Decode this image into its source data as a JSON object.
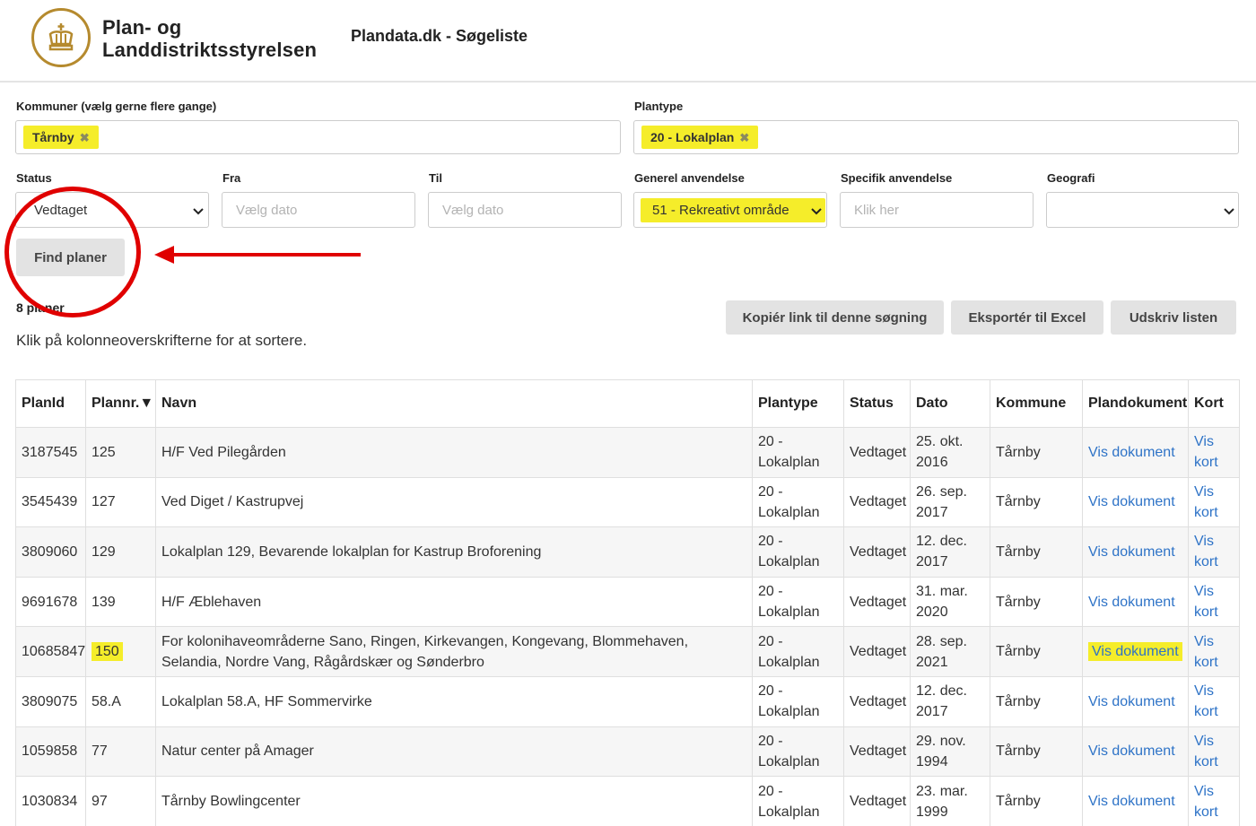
{
  "header": {
    "org_line1": "Plan- og",
    "org_line2": "Landdistriktsstyrelsen",
    "site_title": "Plandata.dk - Søgeliste"
  },
  "filters": {
    "kommuner_label": "Kommuner (vælg gerne flere gange)",
    "kommuner_tag": "Tårnby",
    "plantype_label": "Plantype",
    "plantype_tag": "20 - Lokalplan",
    "status_label": "Status",
    "status_value": "Vedtaget",
    "fra_label": "Fra",
    "fra_placeholder": "Vælg dato",
    "til_label": "Til",
    "til_placeholder": "Vælg dato",
    "generel_label": "Generel anvendelse",
    "generel_value": "51 - Rekreativt område",
    "specifik_label": "Specifik anvendelse",
    "specifik_placeholder": "Klik her",
    "geografi_label": "Geografi",
    "geografi_value": "",
    "tag_remove_glyph": "✖"
  },
  "actions": {
    "find": "Find planer",
    "copy_link": "Kopiér link til denne søgning",
    "export": "Eksportér til Excel",
    "print": "Udskriv listen"
  },
  "results": {
    "count": "8 planer",
    "hint": "Klik på kolonneoverskrifterne for at sortere."
  },
  "table": {
    "headers": [
      "PlanId",
      "Plannr.▼",
      "Navn",
      "Plantype",
      "Status",
      "Dato",
      "Kommune",
      "Plandokument",
      "Kort"
    ],
    "rows": [
      {
        "id": "3187545",
        "nr": "125",
        "navn": "H/F Ved Pilegården",
        "type1": "20 -",
        "type2": "Lokalplan",
        "status": "Vedtaget",
        "dato1": "25. okt.",
        "dato2": "2016",
        "kommune": "Tårnby",
        "dok": "Vis dokument",
        "kort1": "Vis",
        "kort2": "kort"
      },
      {
        "id": "3545439",
        "nr": "127",
        "navn": "Ved Diget / Kastrupvej",
        "type1": "20 -",
        "type2": "Lokalplan",
        "status": "Vedtaget",
        "dato1": "26. sep.",
        "dato2": "2017",
        "kommune": "Tårnby",
        "dok": "Vis dokument",
        "kort1": "Vis",
        "kort2": "kort"
      },
      {
        "id": "3809060",
        "nr": "129",
        "navn": "Lokalplan 129, Bevarende lokalplan for Kastrup Broforening",
        "type1": "20 -",
        "type2": "Lokalplan",
        "status": "Vedtaget",
        "dato1": "12. dec.",
        "dato2": "2017",
        "kommune": "Tårnby",
        "dok": "Vis dokument",
        "kort1": "Vis",
        "kort2": "kort"
      },
      {
        "id": "9691678",
        "nr": "139",
        "navn": "H/F Æblehaven",
        "type1": "20 -",
        "type2": "Lokalplan",
        "status": "Vedtaget",
        "dato1": "31. mar.",
        "dato2": "2020",
        "kommune": "Tårnby",
        "dok": "Vis dokument",
        "kort1": "Vis",
        "kort2": "kort"
      },
      {
        "id": "10685847",
        "nr": "150",
        "navn": "For kolonihaveområderne Sano, Ringen, Kirkevangen, Kongevang, Blommehaven, Selandia, Nordre Vang, Rågårdskær og Sønderbro",
        "type1": "20 -",
        "type2": "Lokalplan",
        "status": "Vedtaget",
        "dato1": "28. sep.",
        "dato2": "2021",
        "kommune": "Tårnby",
        "dok": "Vis dokument",
        "kort1": "Vis",
        "kort2": "kort"
      },
      {
        "id": "3809075",
        "nr": "58.A",
        "navn": "Lokalplan 58.A, HF Sommervirke",
        "type1": "20 -",
        "type2": "Lokalplan",
        "status": "Vedtaget",
        "dato1": "12. dec.",
        "dato2": "2017",
        "kommune": "Tårnby",
        "dok": "Vis dokument",
        "kort1": "Vis",
        "kort2": "kort"
      },
      {
        "id": "1059858",
        "nr": "77",
        "navn": "Natur center på Amager",
        "type1": "20 -",
        "type2": "Lokalplan",
        "status": "Vedtaget",
        "dato1": "29. nov.",
        "dato2": "1994",
        "kommune": "Tårnby",
        "dok": "Vis dokument",
        "kort1": "Vis",
        "kort2": "kort"
      },
      {
        "id": "1030834",
        "nr": "97",
        "navn": "Tårnby Bowlingcenter",
        "type1": "20 -",
        "type2": "Lokalplan",
        "status": "Vedtaget",
        "dato1": "23. mar.",
        "dato2": "1999",
        "kommune": "Tårnby",
        "dok": "Vis dokument",
        "kort1": "Vis",
        "kort2": "kort"
      }
    ]
  },
  "colors": {
    "highlight": "#f5ed2a",
    "link": "#2e73c7",
    "annotation": "#e00000",
    "logo_gold": "#b58a2e"
  }
}
